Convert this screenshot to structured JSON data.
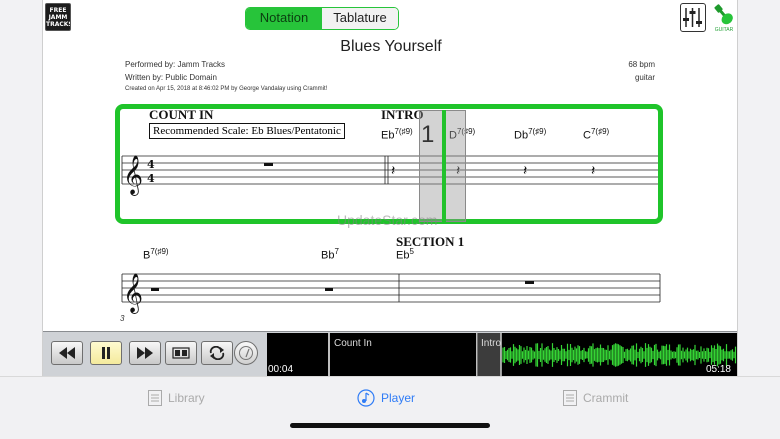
{
  "toolbar": {
    "logo_lines": [
      "FREE",
      "JAMM",
      "TRACKS"
    ],
    "tabs": [
      {
        "label": "Notation",
        "active": true
      },
      {
        "label": "Tablature",
        "active": false
      }
    ],
    "guitar_label": "GUITAR"
  },
  "score": {
    "title": "Blues Yourself",
    "performed_by": "Performed by: Jamm Tracks",
    "written_by": "Written by: Public Domain",
    "created_on": "Created on Apr 15, 2018 at 8:46:02 PM by George Vandalay using Crammit!",
    "tempo": "68 bpm",
    "instrument": "guitar",
    "count_in_label": "COUNT IN",
    "intro_label": "INTRO",
    "section_label": "SECTION 1",
    "recommended_scale": "Recommended Scale: Eb Blues/Pentatonic",
    "beat_number": "1",
    "measure_number": "3",
    "time_signature": "4/4",
    "watermark": "UpdateStar.com",
    "row1_chords": [
      {
        "root": "Eb",
        "quality": "7(♯9)"
      },
      {
        "root": "D",
        "quality": "7(♯9)"
      },
      {
        "root": "Db",
        "quality": "7(♯9)"
      },
      {
        "root": "C",
        "quality": "7(♯9)"
      }
    ],
    "row2_chords": [
      {
        "root": "B",
        "quality": "7(♯9)"
      },
      {
        "root": "Bb",
        "quality": "7"
      },
      {
        "root": "Eb",
        "quality": "5"
      }
    ]
  },
  "transport": {
    "buttons": [
      "rewind",
      "pause",
      "fast-forward",
      "count-in",
      "loop",
      "metronome"
    ],
    "wave_sections": [
      "Count In",
      "Intro"
    ],
    "time_elapsed": "00:04",
    "time_total": "05:18"
  },
  "tabbar": {
    "items": [
      {
        "label": "Library",
        "icon": "list-icon",
        "active": false
      },
      {
        "label": "Player",
        "icon": "music-note-icon",
        "active": true
      },
      {
        "label": "Crammit",
        "icon": "list-icon",
        "active": false
      }
    ]
  },
  "colors": {
    "accent_green": "#27c43a",
    "highlight_green": "#1fc42a",
    "active_tab_blue": "#2f7cf6",
    "waveform_green": "#35d435"
  }
}
